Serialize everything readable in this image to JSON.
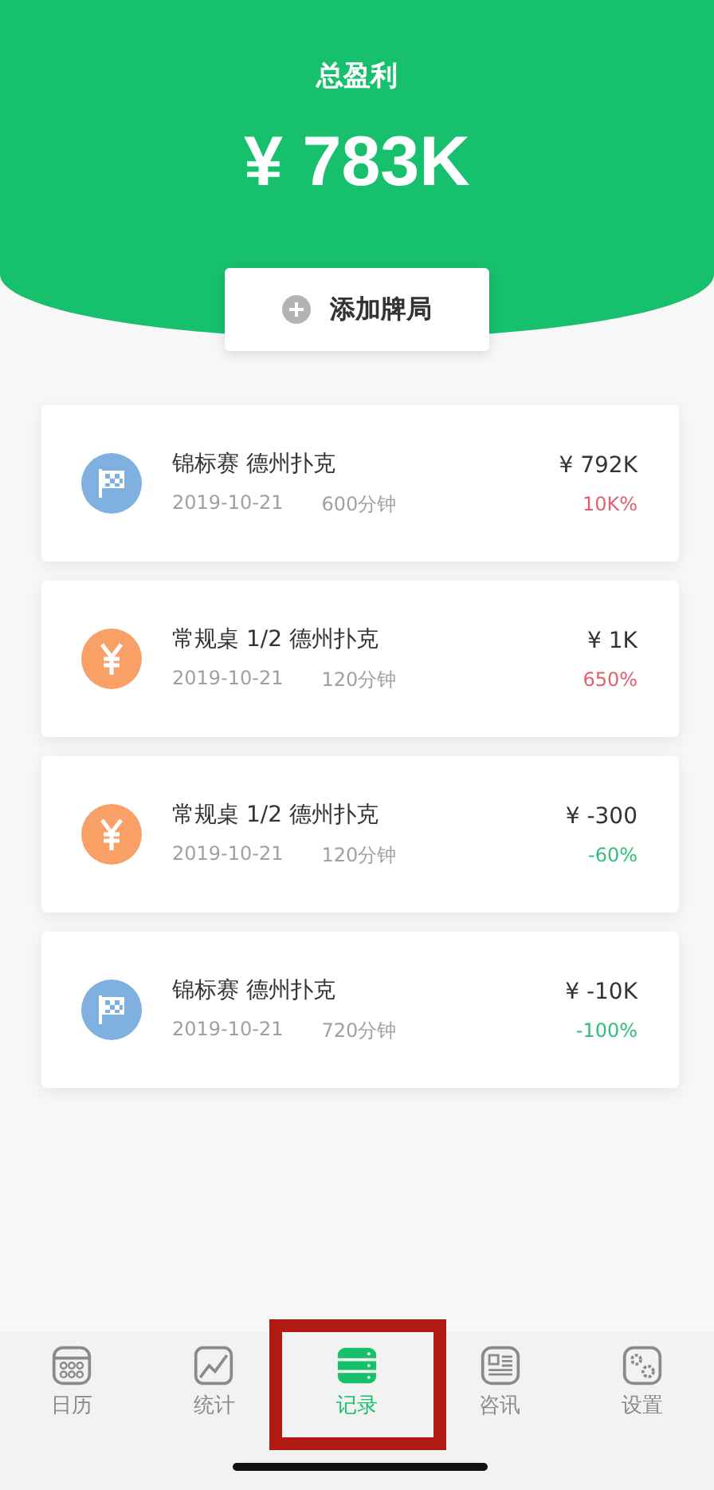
{
  "header": {
    "title": "总盈利",
    "amount": "¥ 783K"
  },
  "add_button": {
    "label": "添加牌局"
  },
  "records": [
    {
      "kind": "tournament",
      "title": "锦标赛 德州扑克",
      "date": "2019-10-21",
      "duration": "600分钟",
      "amount": "¥ 792K",
      "change": "10K%",
      "color": "#e0606e"
    },
    {
      "kind": "cash",
      "title": "常规桌 1/2 德州扑克",
      "date": "2019-10-21",
      "duration": "120分钟",
      "amount": "¥ 1K",
      "change": "650%",
      "color": "#e0606e"
    },
    {
      "kind": "cash",
      "title": "常规桌 1/2 德州扑克",
      "date": "2019-10-21",
      "duration": "120分钟",
      "amount": "¥ -300",
      "change": "-60%",
      "color": "#2fbf7a"
    },
    {
      "kind": "tournament",
      "title": "锦标赛 德州扑克",
      "date": "2019-10-21",
      "duration": "720分钟",
      "amount": "¥ -10K",
      "change": "-100%",
      "color": "#2fbf7a"
    }
  ],
  "tabs": [
    {
      "kind": "calendar",
      "label": "日历",
      "selected": false,
      "highlighted": false
    },
    {
      "kind": "stats",
      "label": "统计",
      "selected": false,
      "highlighted": false
    },
    {
      "kind": "records",
      "label": "记录",
      "selected": true,
      "highlighted": true
    },
    {
      "kind": "news",
      "label": "咨讯",
      "selected": false,
      "highlighted": false
    },
    {
      "kind": "settings",
      "label": "设置",
      "selected": false,
      "highlighted": false
    }
  ]
}
